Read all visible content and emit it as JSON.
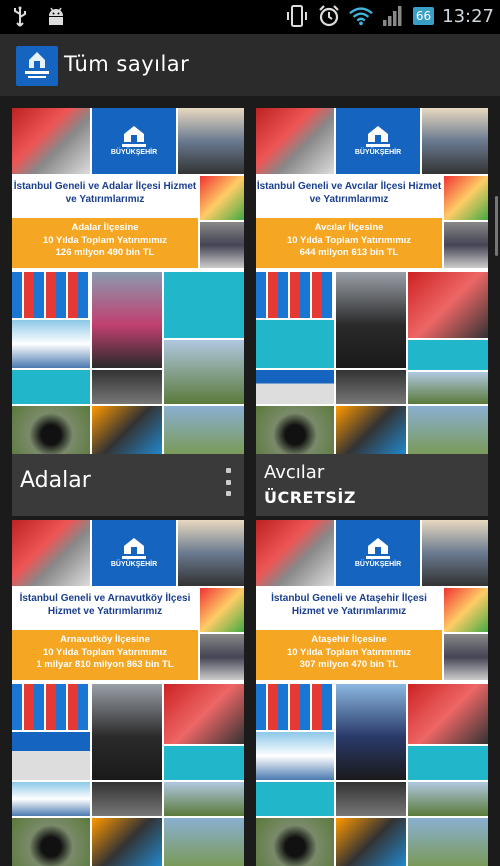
{
  "status_bar": {
    "icons": [
      "usb-icon",
      "android-debug-icon",
      "vibrate-icon",
      "alarm-icon",
      "wifi-icon",
      "signal-icon"
    ],
    "battery": "66",
    "time": "13:27"
  },
  "action_bar": {
    "title": "Tüm sayılar",
    "logo_lines": [
      "İSTANBUL",
      "BÜYÜKŞEHİR",
      "BELEDİYESİ"
    ]
  },
  "issues": [
    {
      "name": "Adalar",
      "price": "",
      "headline": "İstanbul Geneli ve Adalar İlçesi Hizmet ve Yatırımlarımız",
      "box": [
        "Adalar İlçesine",
        "10 Yılda Toplam Yatırımımız",
        "126 milyon 490 bin TL"
      ],
      "has_menu": true
    },
    {
      "name": "Avcılar",
      "price": "ÜCRETSİZ",
      "headline": "İstanbul Geneli ve Avcılar İlçesi Hizmet ve Yatırımlarımız",
      "box": [
        "Avcılar İlçesine",
        "10 Yılda Toplam Yatırımımız",
        "644 milyon 613 bin TL"
      ],
      "has_menu": false
    },
    {
      "name": "",
      "price": "",
      "headline": "İstanbul Geneli ve Arnavutköy İlçesi Hizmet ve Yatırımlarımız",
      "box": [
        "Arnavutköy İlçesine",
        "10 Yılda Toplam Yatırımımız",
        "1 milyar 810 milyon 863 bin TL"
      ],
      "has_menu": false
    },
    {
      "name": "",
      "price": "",
      "headline": "İstanbul Geneli ve Ataşehir İlçesi Hizmet ve Yatırımlarımız",
      "box": [
        "Ataşehir İlçesine",
        "10 Yılda Toplam Yatırımımız",
        "307 milyon 470 bin TL"
      ],
      "has_menu": false
    }
  ],
  "cover_logo_lines": [
    "İSTANBUL",
    "BÜYÜKŞEHİR",
    "BELEDİYESİ"
  ],
  "colors": {
    "brand_blue": "#1565c0",
    "accent_cyan": "#21b6c9",
    "accent_orange": "#f5a623",
    "headline_blue": "#1a3f8f"
  }
}
